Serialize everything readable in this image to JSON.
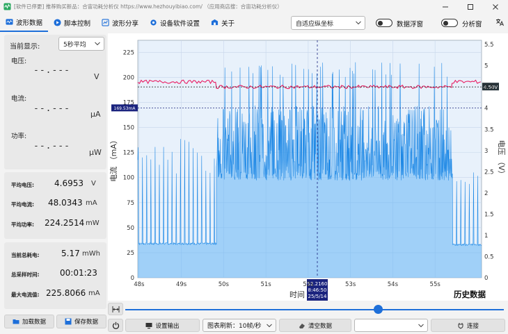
{
  "window": {
    "title": "[软件已停更] 推荐购买新品：合宙功耗分析仪 https://www.hezhouyibiao.com/ （应用商店搜：合宙功耗分析仪）",
    "icon": "waveform-app-icon"
  },
  "menu": {
    "waveform": "波形数据",
    "script": "脚本控制",
    "share": "波形分享",
    "settings": "设备软件设置",
    "about": "关于",
    "axis_mode": "自适应纵坐标",
    "float_window": "数据浮窗",
    "analysis_window": "分析窗",
    "translate_icon": "translate-icon"
  },
  "display": {
    "label": "当前显示:",
    "mode": "5秒平均"
  },
  "meters": {
    "voltage_label": "电压:",
    "voltage_value": "--.---",
    "voltage_unit": "V",
    "current_label": "电流:",
    "current_value": "--.---",
    "current_unit": "µA",
    "power_label": "功率:",
    "power_value": "--.---",
    "power_unit": "µW"
  },
  "averages": {
    "voltage_label": "平均电压:",
    "voltage_value": "4.6953",
    "voltage_unit": "V",
    "current_label": "平均电流:",
    "current_value": "48.0343",
    "current_unit": "mA",
    "power_label": "平均功率:",
    "power_value": "224.2514",
    "power_unit": "mW"
  },
  "totals": {
    "energy_label": "当前总耗电:",
    "energy_value": "5.17",
    "energy_unit": "mWh",
    "time_label": "总采样时间:",
    "time_value": "00:01:23",
    "max_label": "最大电流值:",
    "max_value": "225.8066",
    "max_unit": "mA"
  },
  "buttons": {
    "load": "加载数据",
    "save": "保存数据",
    "output_settings": "设置输出",
    "refresh": "图表刷新：10帧/秒",
    "clear": "清空数据",
    "port": "",
    "connect": "连接"
  },
  "chart_data": {
    "type": "line",
    "xlabel": "时间",
    "ylabel_left": "电流 （mA）",
    "ylabel_right": "电压 （V）",
    "history_label": "历史数据",
    "x_ticks": [
      "48s",
      "49s",
      "50s",
      "51s",
      "52s",
      "53s",
      "54s",
      "55s"
    ],
    "xlim": [
      47.97,
      56.1
    ],
    "ylim_left": [
      0,
      237
    ],
    "ylim_right": [
      0,
      5.6
    ],
    "y_ticks_left": [
      0,
      25,
      50,
      75,
      100,
      125,
      150,
      175,
      200,
      225
    ],
    "y_ticks_right": [
      0,
      0.5,
      1,
      1.5,
      2,
      2.5,
      3,
      3.5,
      4,
      4.5,
      5,
      5.5
    ],
    "grid": true,
    "series": [
      {
        "name": "current",
        "unit": "mA",
        "segments": [
          {
            "x_start": 47.97,
            "x_end": 49.83,
            "baseline": 34,
            "spike_top": 140,
            "spike_every_s": 0.1
          },
          {
            "x_start": 49.83,
            "x_end": 55.4,
            "low": 97,
            "high": 172,
            "top": 215
          },
          {
            "x_start": 55.4,
            "x_end": 56.1,
            "baseline": 33,
            "spike_top": 120,
            "spike_every_s": 0.1
          }
        ]
      },
      {
        "name": "voltage",
        "unit": "V",
        "segments": [
          {
            "x_start": 47.97,
            "x_end": 49.83,
            "value": 4.62
          },
          {
            "x_start": 49.83,
            "x_end": 55.4,
            "value": 4.5
          },
          {
            "x_start": 55.4,
            "x_end": 56.1,
            "value": 4.62
          }
        ]
      }
    ],
    "markers": {
      "voltage_line": 4.5,
      "voltage_label": "4.50V",
      "current_line": 169.53,
      "current_label": "169.53mA",
      "cursor_x": 52.216,
      "cursor_value": "52.2160",
      "cursor_time": "8:46:50",
      "cursor_date": "25/5/14"
    },
    "colors": {
      "current": "#1e88e5",
      "current_fill": "#64b5f6",
      "voltage": "#e91e63",
      "plot_bg": "#e8f1fb"
    }
  }
}
